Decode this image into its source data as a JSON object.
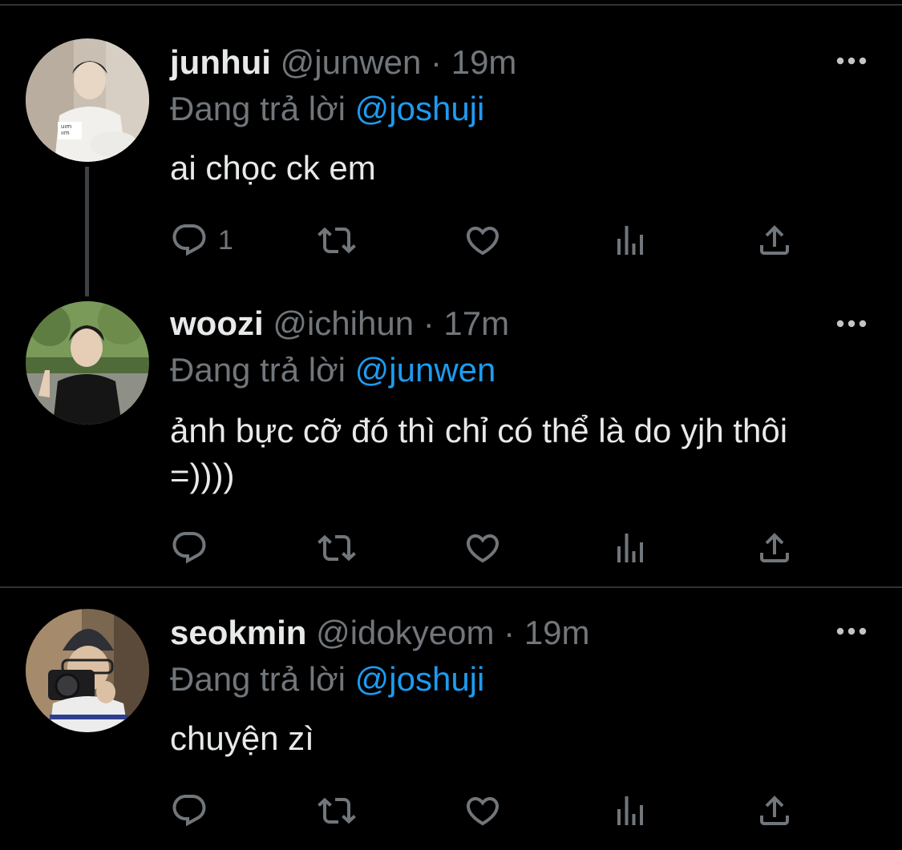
{
  "tweets": [
    {
      "name": "junhui",
      "handle": "@junwen",
      "separator": "·",
      "time": "19m",
      "reply_prefix": "Đang trả lời",
      "reply_mention": "@joshuji",
      "text": "ai chọc ck em",
      "reply_count": "1",
      "avatar_icon": "avatar-photo-light-hoodie",
      "more_icon": "more-dots-icon"
    },
    {
      "name": "woozi",
      "handle": "@ichihun",
      "separator": "·",
      "time": "17m",
      "reply_prefix": "Đang trả lời",
      "reply_mention": "@junwen",
      "text": "ảnh bực cỡ đó thì chỉ có thể là do yjh thôi =))))",
      "reply_count": "",
      "avatar_icon": "avatar-photo-outdoor-peace-sign",
      "more_icon": "more-dots-icon"
    },
    {
      "name": "seokmin",
      "handle": "@idokyeom",
      "separator": "·",
      "time": "19m",
      "reply_prefix": "Đang trả lời",
      "reply_mention": "@joshuji",
      "text": "chuyện zì",
      "reply_count": "",
      "avatar_icon": "avatar-photo-beanie-camera",
      "more_icon": "more-dots-icon"
    }
  ],
  "colors": {
    "background": "#000000",
    "text": "#e7e9ea",
    "secondary": "#71767b",
    "mention": "#1d9bf0",
    "divider": "#2f3336"
  },
  "action_icons": [
    "reply-icon",
    "retweet-icon",
    "like-icon",
    "views-icon",
    "share-icon"
  ]
}
